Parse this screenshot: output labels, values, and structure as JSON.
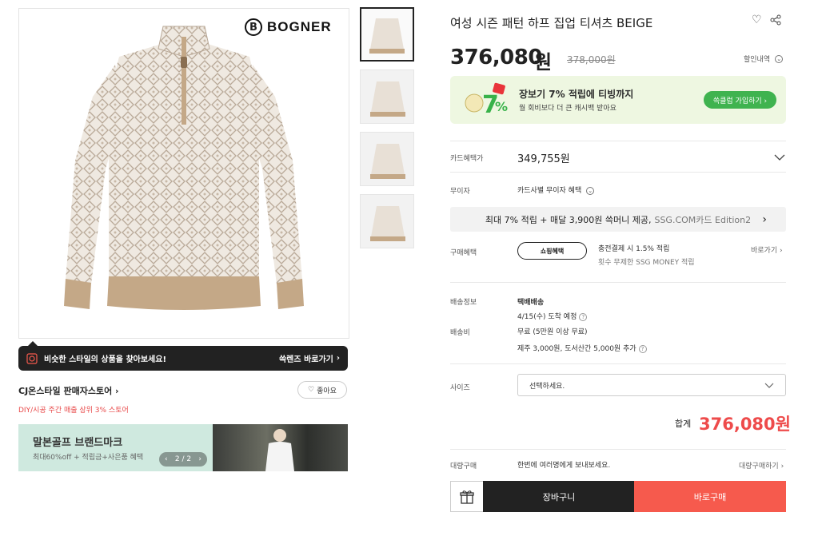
{
  "brand": "BOGNER",
  "product": {
    "title": "여성 시즌 패턴 하프 집업 티셔츠 BEIGE",
    "price": "376,080",
    "price_unit": "원",
    "original_price": "378,000원",
    "discount_link": "할인내역"
  },
  "promo": {
    "line1": "장보기 7% 적립에 티빙까지",
    "line2": "월 회비보다 더 큰 캐시백 받아요",
    "button": "쓱클럽 가입하기 ›"
  },
  "card": {
    "label": "카드혜택가",
    "price": "349,755원"
  },
  "installment": {
    "label": "무이자",
    "value": "카드사별 무이자 혜택"
  },
  "benefit_bar": {
    "bold": "최대 7% 적립 + 매달 3,900원 쓱머니 제공,",
    "grey": "SSG.COM카드 Edition2"
  },
  "purchase_benefit": {
    "label": "구매혜택",
    "button": "쇼핑혜택",
    "line1": "충전결제 시 1.5% 적립",
    "line2": "횟수 무제한 SSG MONEY 적립",
    "more": "바로가기"
  },
  "shipping": {
    "label": "배송정보",
    "type": "택배배송",
    "eta": "4/15(수) 도착 예정",
    "fee_label": "배송비",
    "fee": "무료 (5만원 이상 무료)",
    "extra": "제주 3,000원, 도서산간 5,000원 추가"
  },
  "size": {
    "label": "사이즈",
    "placeholder": "선택하세요."
  },
  "total": {
    "label": "합계",
    "price": "376,080원"
  },
  "bulk": {
    "label": "대량구매",
    "text": "한번에 여러명에게 보내보세요.",
    "link": "대량구매하기"
  },
  "actions": {
    "cart": "장바구니",
    "buy": "바로구매"
  },
  "style_search": {
    "text": "비슷한 스타일의 상품을 찾아보세요!",
    "link": "쓱렌즈 바로가기"
  },
  "store": {
    "name": "CJ온스타일 판매자스토어",
    "sub": "DIY/시공 주간 매출 상위 3% 스토어",
    "like": "좋아요"
  },
  "banner": {
    "title": "말본골프 브랜드마크",
    "subtitle": "최대60%off + 적립금+사은품 혜택",
    "page": "2 / 2"
  },
  "colors": {
    "accent_red": "#ee4b4b",
    "buy_button": "#f65a4d",
    "club_green": "#3fb34f",
    "dark": "#222222"
  }
}
